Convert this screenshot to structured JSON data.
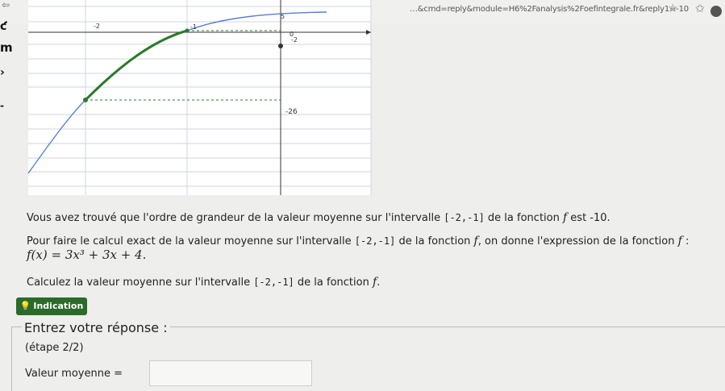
{
  "browser": {
    "url": "…&cmd=reply&module=H6%2Fanalysis%2Foefintegrale.fr&reply1=-10"
  },
  "graph": {
    "labels": {
      "x_minus2": "-2",
      "tick_minus1": "-1",
      "tick_0": "0",
      "y_minus2": "-2",
      "y_minus26": "-26",
      "top_tick": "5"
    }
  },
  "text": {
    "p1_a": "Vous avez trouvé que l'ordre de grandeur de la valeur moyenne sur l'intervalle ",
    "p1_interval": "[-2,-1]",
    "p1_b": " de la fonction ",
    "p1_f": "f",
    "p1_c": " est -10.",
    "p2_a": "Pour faire le calcul exact de la valeur moyenne sur l'intervalle ",
    "p2_interval": "[-2,-1]",
    "p2_b": " de la fonction ",
    "p2_f": "f",
    "p2_c": ", on donne l'expression de la fonction ",
    "p2_f2": "f",
    "p2_d": " :",
    "formula": "f(x) = 3x³ + 3x + 4.",
    "p3_a": "Calculez la valeur moyenne sur l'intervalle ",
    "p3_interval": "[-2,-1]",
    "p3_b": " de la fonction ",
    "p3_f": "f",
    "p3_c": "."
  },
  "indication": {
    "label": "Indication"
  },
  "form": {
    "legend": "Entrez votre réponse :",
    "step": "(étape 2/2)",
    "answer_label": "Valeur moyenne =",
    "answer_value": ""
  }
}
